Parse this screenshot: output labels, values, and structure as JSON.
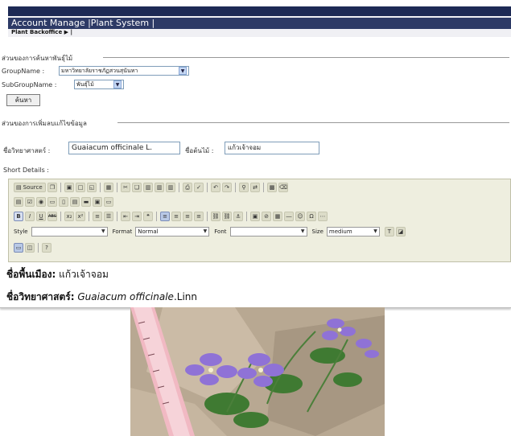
{
  "header": {
    "app_title": "Account Manage |Plant System |",
    "breadcrumb": "Plant Backoffice ▶ |"
  },
  "search_section": {
    "title": "ส่วนของการค้นหาพันธุ์ไม้",
    "group_label": "GroupName :",
    "group_value": "มหาวิทยาลัยราชภัฏสวนสุนันทา",
    "subgroup_label": "SubGroupName :",
    "subgroup_value": "พันธุ์ไม้",
    "search_button": "ค้นหา"
  },
  "edit_section": {
    "title": "ส่วนของการเพิ่มลบแก้ไขข้อมูล",
    "scientific_label": "ชื่อวิทยาศาสตร์ :",
    "scientific_value": "Guaiacum officinale L.",
    "plant_label": "ชื่อต้นไม้ :",
    "plant_value": "แก้วเจ้าจอม",
    "short_details_label": "Short Details :"
  },
  "toolbar": {
    "source_label": "Source",
    "style_label": "Style",
    "format_label": "Format",
    "format_value": "Normal",
    "font_label": "Font",
    "size_label": "Size",
    "size_value": "medium",
    "row2_icons": [
      "B",
      "I",
      "U",
      "ABC",
      "x₂",
      "x²",
      "1.",
      "•",
      "⇤",
      "⇥",
      "❝"
    ]
  },
  "content": {
    "local_name_label": "ชื่อพื้นเมือง:",
    "local_name_value": "แก้วเจ้าจอม",
    "scientific_name_label": "ชื่อวิทยาศาสตร์:",
    "scientific_name_italic": "Guaiacum officinale",
    "scientific_name_suffix": ".Linn"
  },
  "colors": {
    "header_bar": "#1d2a55",
    "editor_bg": "#eeeedf",
    "flower": "#8f72d6",
    "ruler": "#f1b9c3"
  }
}
